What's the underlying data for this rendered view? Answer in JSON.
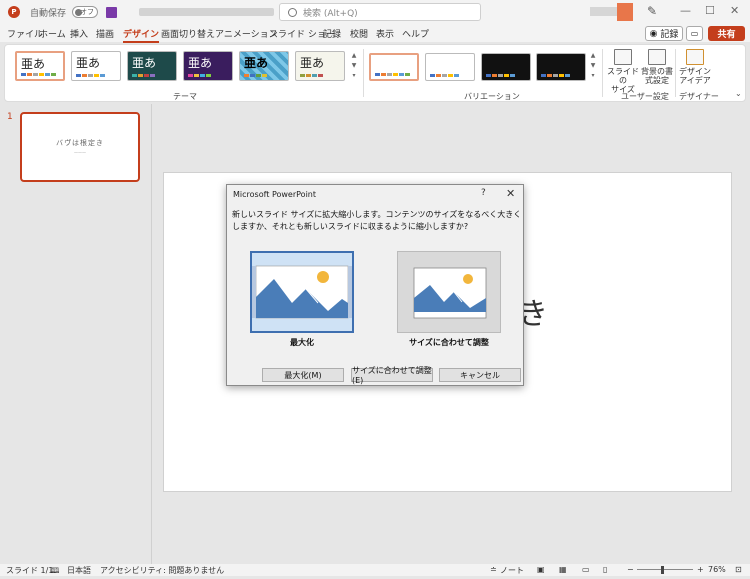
{
  "titlebar": {
    "autosave_label": "自動保存",
    "autosave_state": "オフ",
    "search_placeholder": "検索 (Alt+Q)"
  },
  "menu": {
    "tabs": [
      "ファイル",
      "ホーム",
      "挿入",
      "描画",
      "デザイン",
      "画面切り替え",
      "アニメーション",
      "スライド ショー",
      "記録",
      "校閲",
      "表示",
      "ヘルプ"
    ],
    "active_tab": "デザイン",
    "record_label": "記録",
    "share_label": "共有"
  },
  "ribbon": {
    "themes": [
      {
        "label": "亜あ"
      },
      {
        "label": "亜あ"
      },
      {
        "label": "亜あ"
      },
      {
        "label": "亜あ"
      },
      {
        "label": "亜あ"
      },
      {
        "label": "亜あ"
      }
    ],
    "theme_group_label": "テーマ",
    "variation_group_label": "バリエーション",
    "slide_size_label": "スライドの\nサイズ",
    "bg_format_label": "背景の書\n式設定",
    "user_group_label": "ユーザー設定",
    "design_ideas_label": "デザイン\nアイデア",
    "designer_group_label": "デザイナー"
  },
  "slides_panel": {
    "number": "1",
    "thumb_title": "バウ゚は根定き"
  },
  "slide": {
    "visible_text": "き"
  },
  "dialog": {
    "title": "Microsoft PowerPoint",
    "help": "?",
    "close": "✕",
    "message": "新しいスライド サイズに拡大縮小します。コンテンツのサイズをなるべく大きくしますか、それとも新しいスライドに収まるように縮小しますか?",
    "option_maximize_label": "最大化",
    "option_fit_label": "サイズに合わせて調整",
    "btn_maximize": "最大化(M)",
    "btn_fit": "サイズに合わせて調整(E)",
    "btn_cancel": "キャンセル"
  },
  "statusbar": {
    "slide_count": "スライド 1/1",
    "language": "日本語",
    "accessibility": "アクセシビリティ: 問題ありません",
    "notes": "ノート",
    "zoom": "76%"
  },
  "colors": {
    "accent": "#c43e1c",
    "selection_blue": "#3e6fb0"
  }
}
